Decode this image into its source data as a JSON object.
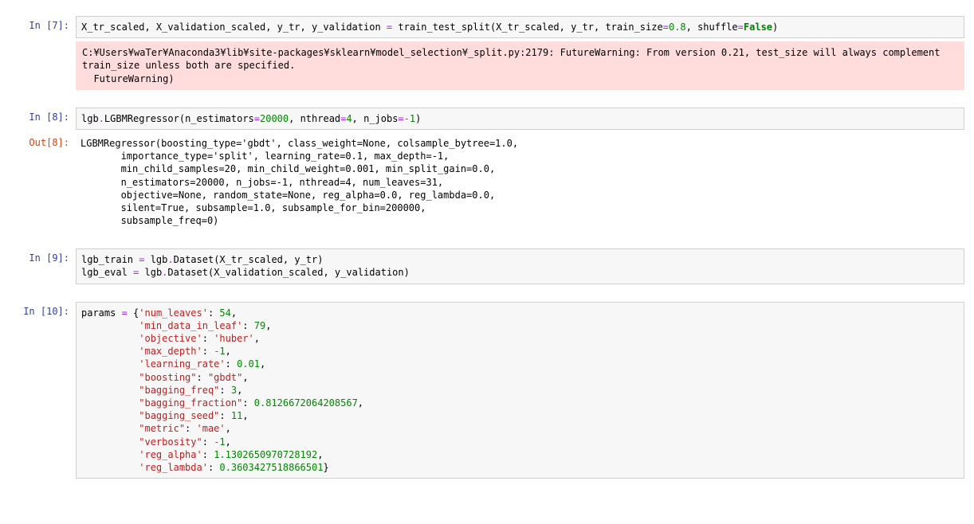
{
  "cells": {
    "c7": {
      "prompt": "In [7]:",
      "warning": "C:¥Users¥waTer¥Anaconda3¥lib¥site-packages¥sklearn¥model_selection¥_split.py:2179: FutureWarning: From version 0.21, test_size will always complement train_size unless both are specified.\n  FutureWarning)"
    },
    "c8": {
      "prompt": "In [8]:",
      "out_prompt": "Out[8]:",
      "output": "LGBMRegressor(boosting_type='gbdt', class_weight=None, colsample_bytree=1.0,\n       importance_type='split', learning_rate=0.1, max_depth=-1,\n       min_child_samples=20, min_child_weight=0.001, min_split_gain=0.0,\n       n_estimators=20000, n_jobs=-1, nthread=4, num_leaves=31,\n       objective=None, random_state=None, reg_alpha=0.0, reg_lambda=0.0,\n       silent=True, subsample=1.0, subsample_for_bin=200000,\n       subsample_freq=0)"
    },
    "c9": {
      "prompt": "In [9]:"
    },
    "c10": {
      "prompt": "In [10]:"
    }
  },
  "code": {
    "c7": {
      "vars": "X_tr_scaled, X_validation_scaled, y_tr, y_validation ",
      "eq": "=",
      "fn": " train_test_split(X_tr_scaled, y_tr, train_size",
      "eq2": "=",
      "num": "0.8",
      "mid": ", shuffle",
      "eq3": "=",
      "false": "False",
      "end": ")"
    },
    "c8": {
      "pre": "lgb",
      "dot": ".",
      "call": "LGBMRegressor(n_estimators",
      "eq": "=",
      "n1": "20000",
      "m1": ", nthread",
      "eq2": "=",
      "n2": "4",
      "m2": ", n_jobs",
      "eq3": "=",
      "minus": "-",
      "n3": "1",
      "end": ")"
    },
    "c9": {
      "l1a": "lgb_train ",
      "eq1": "=",
      "l1b": " lgb",
      "dot1": ".",
      "l1c": "Dataset(X_tr_scaled, y_tr)",
      "l2a": "lgb_eval ",
      "eq2": "=",
      "l2b": " lgb",
      "dot2": ".",
      "l2c": "Dataset(X_validation_scaled, y_validation)"
    },
    "c10": {
      "head": "params ",
      "eq": "=",
      "brace": " {",
      "k1": "'num_leaves'",
      "v1": "54",
      "k2": "'min_data_in_leaf'",
      "v2": "79",
      "k3": "'objective'",
      "v3": "'huber'",
      "k4": "'max_depth'",
      "v4m": "-",
      "v4": "1",
      "k5": "'learning_rate'",
      "v5": "0.01",
      "k6": "\"boosting\"",
      "v6": "\"gbdt\"",
      "k7": "\"bagging_freq\"",
      "v7": "3",
      "k8": "\"bagging_fraction\"",
      "v8": "0.8126672064208567",
      "k9": "\"bagging_seed\"",
      "v9": "11",
      "k10": "\"metric\"",
      "v10": "'mae'",
      "k11": "\"verbosity\"",
      "v11m": "-",
      "v11": "1",
      "k12": "'reg_alpha'",
      "v12": "1.1302650970728192",
      "k13": "'reg_lambda'",
      "v13": "0.3603427518866501",
      "close": "}"
    }
  }
}
